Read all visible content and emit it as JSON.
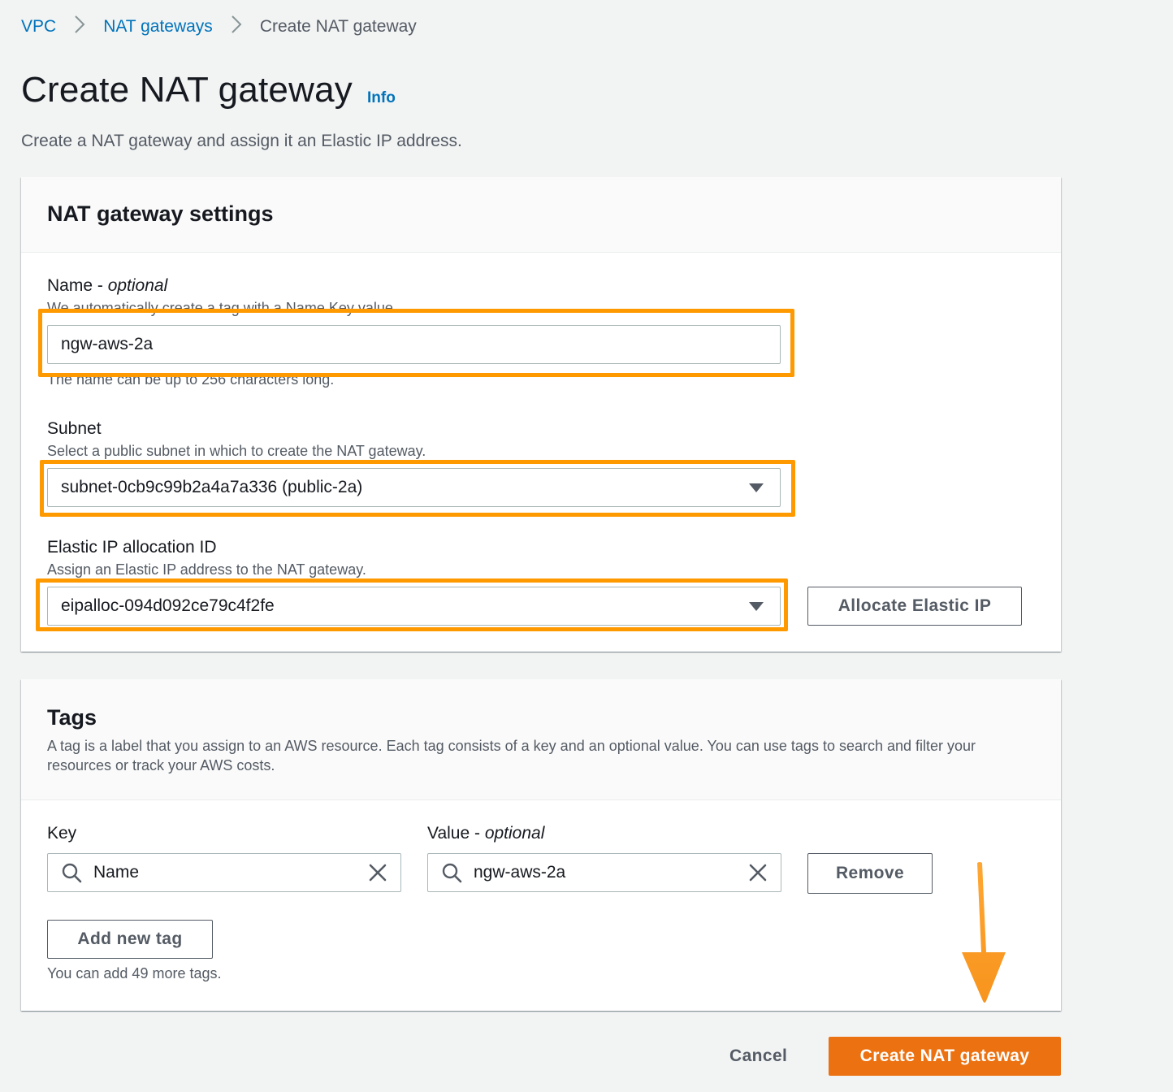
{
  "breadcrumb": {
    "items": [
      {
        "label": "VPC"
      },
      {
        "label": "NAT gateways"
      },
      {
        "label": "Create NAT gateway"
      }
    ]
  },
  "page": {
    "title": "Create NAT gateway",
    "info_link": "Info",
    "description": "Create a NAT gateway and assign it an Elastic IP address."
  },
  "settings": {
    "title": "NAT gateway settings",
    "name": {
      "label": "Name -",
      "label_optional": "optional",
      "hint_top": "We automatically create a tag with a Name Key value.",
      "value": "ngw-aws-2a",
      "hint_bottom": "The name can be up to 256 characters long."
    },
    "subnet": {
      "label": "Subnet",
      "hint": "Select a public subnet in which to create the NAT gateway.",
      "value": "subnet-0cb9c99b2a4a7a336 (public-2a)"
    },
    "eip": {
      "label": "Elastic IP allocation ID",
      "hint": "Assign an Elastic IP address to the NAT gateway.",
      "value": "eipalloc-094d092ce79c4f2fe",
      "allocate_button": "Allocate Elastic IP"
    }
  },
  "tags": {
    "title": "Tags",
    "description": "A tag is a label that you assign to an AWS resource. Each tag consists of a key and an optional value. You can use tags to search and filter your resources or track your AWS costs.",
    "key_label": "Key",
    "value_label": "Value -",
    "value_label_optional": "optional",
    "rows": [
      {
        "key": "Name",
        "value": "ngw-aws-2a"
      }
    ],
    "remove_button": "Remove",
    "add_button": "Add new tag",
    "remaining": "You can add 49 more tags."
  },
  "actions": {
    "cancel": "Cancel",
    "create": "Create NAT gateway"
  },
  "colors": {
    "highlight": "#ff9900",
    "primary": "#ec7211",
    "link": "#0073bb"
  },
  "icons": {
    "separator": "chevron-right-icon",
    "dropdown": "caret-down-icon",
    "search": "search-icon",
    "clear": "close-icon",
    "annotation": "arrow-down-icon"
  }
}
